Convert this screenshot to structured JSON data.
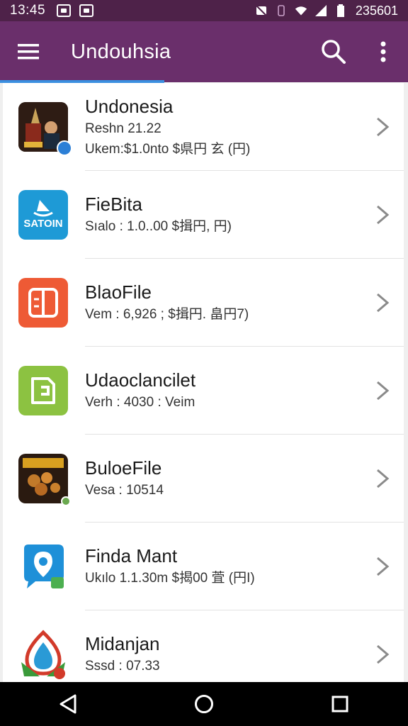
{
  "status_bar": {
    "time": "13:45",
    "right_text": "235601"
  },
  "app_bar": {
    "title": "Undouhsia"
  },
  "colors": {
    "status_bar": "#4e2249",
    "app_bar": "#6a2f6b",
    "progress": "#3b8fe0"
  },
  "items": [
    {
      "name": "Undonesia",
      "lines": [
        "Reshn 21.22",
        "Ukem:$1.0nto $県円 玄 (円)"
      ],
      "icon": "photo-icon"
    },
    {
      "name": "FieBita",
      "lines": [
        "Sıalo : 1.0..00 $揖円, 円)"
      ],
      "icon": "satoin-app-icon"
    },
    {
      "name": "BlaoFile",
      "lines": [
        "Vem : 6,926 ; $揖円. 畠円7)"
      ],
      "icon": "split-app-icon"
    },
    {
      "name": "Udaoclancilet",
      "lines": [
        "Verh : 4030 : Veim"
      ],
      "icon": "file-app-icon"
    },
    {
      "name": "BuloeFile",
      "lines": [
        "Vesa : 10514"
      ],
      "icon": "food-photo-icon"
    },
    {
      "name": "Finda Mant",
      "lines": [
        "Ukılo 1.1.30m $揭00 萓 (円I)"
      ],
      "icon": "map-pin-app-icon"
    },
    {
      "name": "Midanjan",
      "lines": [
        "Sssd : 07.33"
      ],
      "icon": "droplet-app-icon"
    }
  ]
}
